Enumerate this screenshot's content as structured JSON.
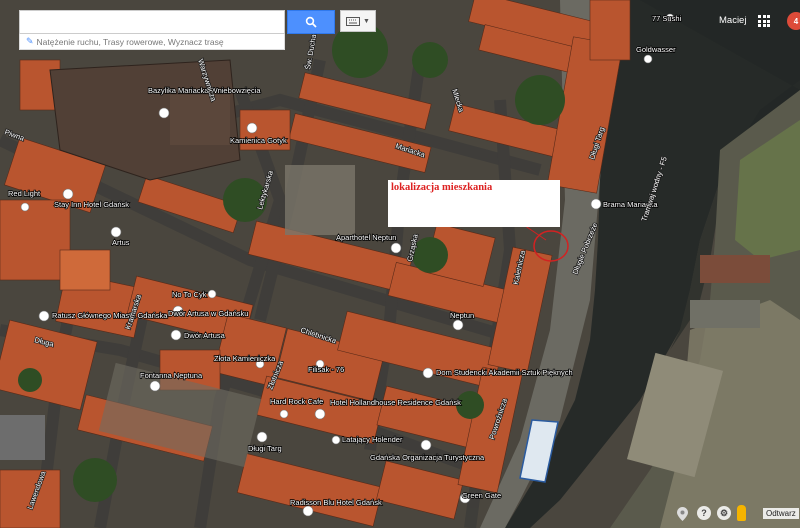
{
  "search": {
    "value": "",
    "placeholder": ""
  },
  "layers": {
    "text": "Natężenie ruchu, Trasy rowerowe, Wyznacz trasę"
  },
  "user": {
    "name": "Maciej",
    "notifications": "4"
  },
  "annotation": {
    "text": "lokalizacja mieszkania",
    "color": "#d22222"
  },
  "bottom_right": {
    "help": "?",
    "label": "Odtwarz"
  },
  "streets": {
    "piwna": "Piwna",
    "chlebnicka": "Chlebnicka",
    "mariacka": "Mariacka",
    "dluga": "Długa",
    "kramarska": "Kramarska",
    "lawendowa": "Lawendowa",
    "mlynska": "Mlecka",
    "dlugie_pobrzeze": "Długie Pobrzeże",
    "grzaska": "Grząska",
    "zlotniczna": "Złotnicza",
    "powroznicza": "Powroźnicza",
    "trakt": "Tramwaj wodny - F5",
    "warzywnicza": "Warzywnicza",
    "lektykarska": "Lektykarska",
    "sw_ducha": "Św. Ducha",
    "dlugi_targ": "Długi Targ",
    "kramarska2": "Kramarska",
    "kaletnicza": "Kaletnicza"
  },
  "pois": {
    "sushi": "77 Sushi",
    "goldwasser": "Goldwasser",
    "bazylika": "Bazylika Mariacka Wniebowzięcia",
    "kamienica": "Kamienica Gotyk",
    "red_light": "Red Light",
    "stay_inn": "Stay Inn Hotel Gdańsk",
    "artus": "Artus",
    "brama": "Brama Mariacka",
    "aparthotel": "Aparthotel Neptun",
    "neptun": "Neptun",
    "no_to_cyk": "No To Cyk",
    "dwor_artusa_gdansk": "Dwór Artusa w Gdańsku",
    "dwor_artusa": "Dwór Artusa",
    "ratusz": "Ratusz Głównego Miasta Gdańska",
    "zlota": "Złota Kamieniczka",
    "filisak": "Filisak - 76",
    "dom": "Dom Studencki Akademii Sztuk Pięknych",
    "fontanna": "Fontanna Neptuna",
    "hard_rock": "Hard Rock Cafe",
    "holland": "Hotel Hollandhouse Residence Gdańsk",
    "latajacy": "Latający Holender",
    "dlugi_targ": "Długi Targ",
    "organizacja": "Gdańska Organizacja Turystyczna",
    "green_gate": "Green Gate",
    "radisson": "Radisson Blu Hotel Gdańsk"
  }
}
